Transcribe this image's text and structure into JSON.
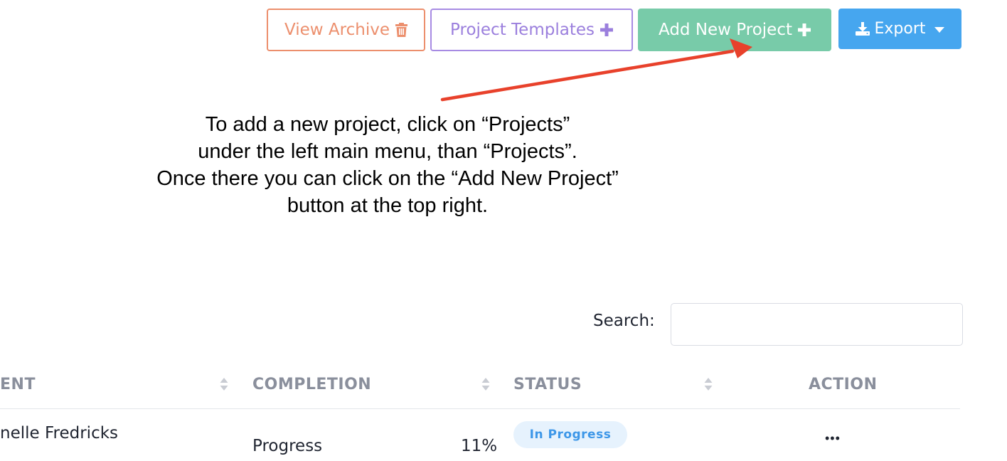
{
  "toolbar": {
    "view_archive_label": "View Archive",
    "project_templates_label": "Project Templates",
    "add_new_project_label": "Add New Project",
    "export_label": "Export"
  },
  "instruction": {
    "lines": [
      "To add a new project, click on “Projects”",
      "under the left main menu, than “Projects”.",
      "Once there you can click on the “Add New Project”",
      "button at the top right."
    ]
  },
  "search": {
    "label": "Search:",
    "value": ""
  },
  "table": {
    "columns": [
      {
        "label": "ENT"
      },
      {
        "label": "COMPLETION"
      },
      {
        "label": "STATUS"
      },
      {
        "label": "ACTION"
      }
    ],
    "rows": [
      {
        "client": "nelle Fredricks",
        "completion_label": "Progress",
        "completion_value": "11%",
        "status": "In Progress",
        "action": "•••"
      }
    ]
  },
  "colors": {
    "archive": "#ec8f6d",
    "templates": "#a78be3",
    "add": "#78cba9",
    "export": "#46a6ef",
    "arrow": "#e8412b",
    "status_badge_bg": "#e6f2fd",
    "status_badge_text": "#3d97e8"
  },
  "icons": {
    "archive": "trash-icon",
    "templates": "plus-icon",
    "add": "plus-icon",
    "export_left": "download-icon",
    "export_right": "caret-down-icon",
    "sort": "sort-icon",
    "action": "ellipsis-icon"
  }
}
